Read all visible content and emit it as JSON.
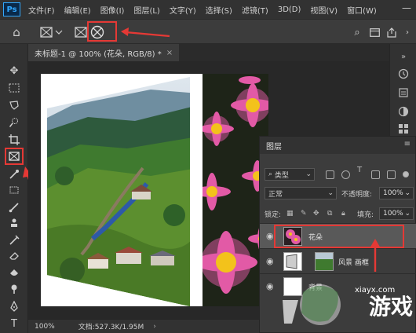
{
  "menu": {
    "logo": "Ps",
    "items": [
      "文件(F)",
      "编辑(E)",
      "图像(I)",
      "图层(L)",
      "文字(Y)",
      "选择(S)",
      "滤镜(T)",
      "3D(D)",
      "视图(V)",
      "窗口(W)"
    ]
  },
  "options_bar": {
    "tool_icon": "frame-tool-icon",
    "shape_rect_icon": "rectangle-frame-icon",
    "shape_ellipse_icon": "ellipse-frame-icon"
  },
  "document": {
    "tab_title": "未标题-1 @ 100% (花朵, RGB/8) *",
    "tab_close": "×"
  },
  "status": {
    "zoom": "100%",
    "doc_size": "文档:527.3K/1.95M",
    "arrow": "›"
  },
  "layers": {
    "title": "图层",
    "kind_filter": "类型",
    "blend_mode": "正常",
    "opacity_label": "不透明度:",
    "opacity": "100%",
    "lock_label": "锁定:",
    "fill_label": "填充:",
    "fill": "100%",
    "items": [
      {
        "name": "花朵",
        "selected": true
      },
      {
        "name": "风景 画框",
        "selected": false
      },
      {
        "name": "背景",
        "selected": false
      }
    ]
  },
  "watermark": {
    "text": "游戏",
    "domain": "xiayx.com"
  },
  "colors": {
    "highlight": "#e53935",
    "panel_bg": "#3c3c3c",
    "app_bg": "#323232",
    "selected_layer": "#595959"
  }
}
